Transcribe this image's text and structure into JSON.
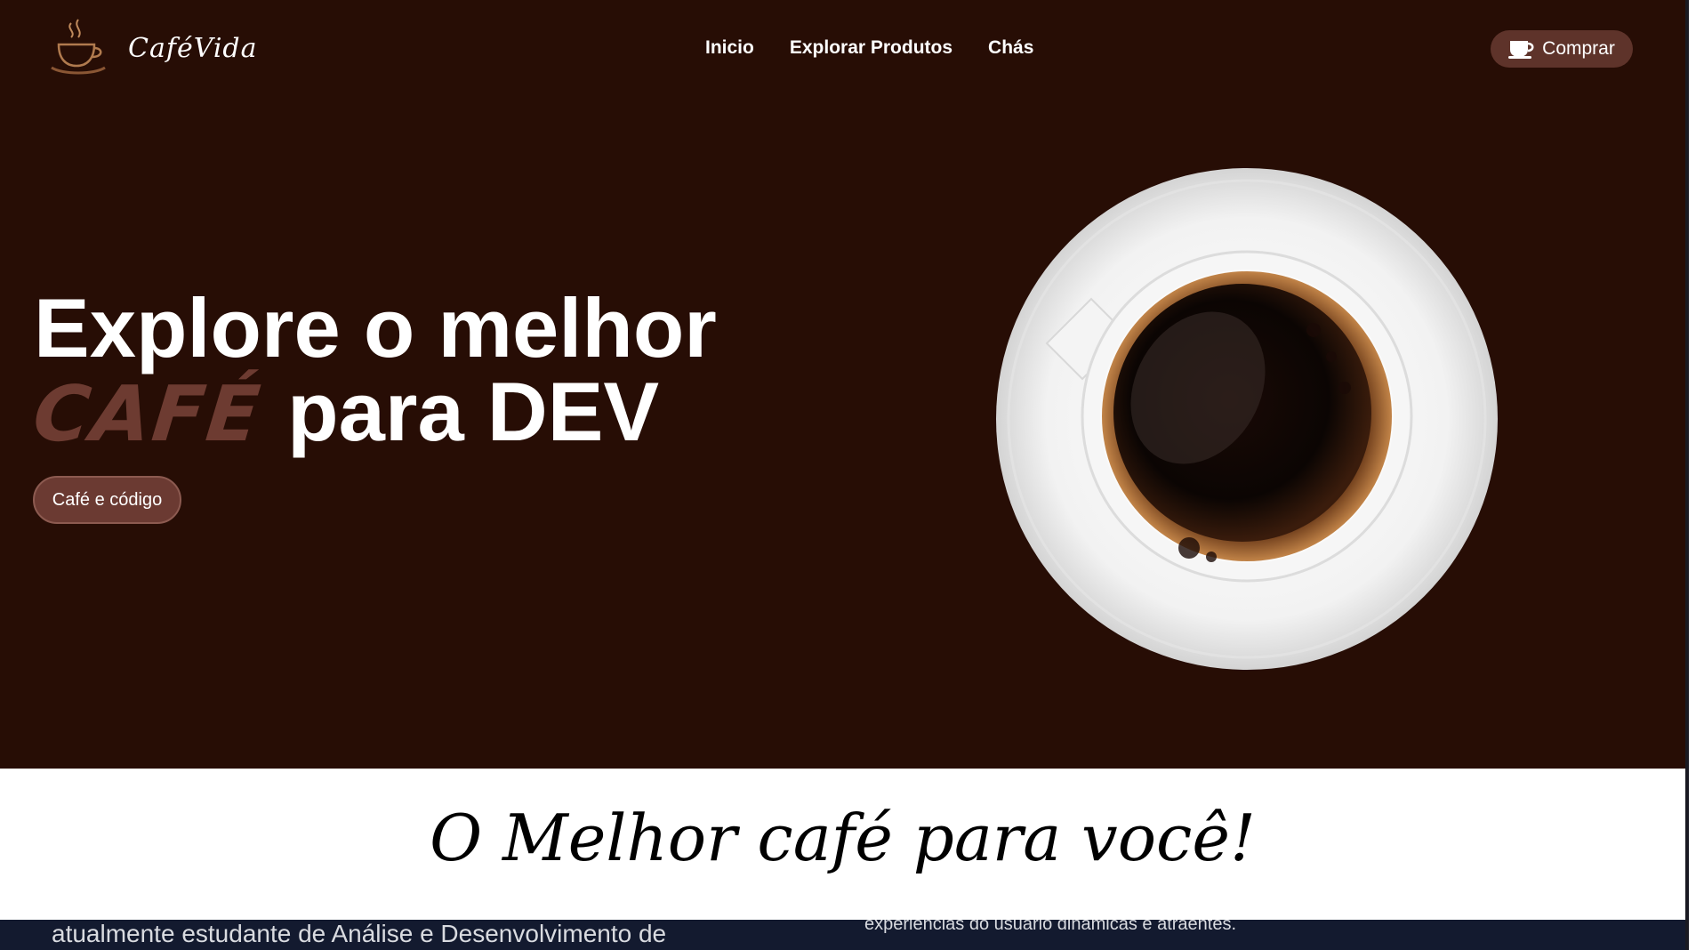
{
  "brand": {
    "name": "CaféVida",
    "logo_icon": "coffee-cup-icon"
  },
  "nav": {
    "items": [
      "Inicio",
      "Explorar Produtos",
      "Chás"
    ]
  },
  "header": {
    "buy_label": "Comprar",
    "buy_icon": "coffee-cup-icon"
  },
  "hero": {
    "headline_line1": "Explore o melhor",
    "headline_accent": "CAFÉ",
    "headline_rest": "para DEV",
    "cta_label": "Café e código",
    "image": "coffee-cup-top-view"
  },
  "section": {
    "tagline": "O Melhor café para você!",
    "partial_text_left": "atualmente estudante de Análise e Desenvolvimento de",
    "partial_text_right": "experiências do usuário dinâmicas e atraentes."
  },
  "colors": {
    "hero_bg": "#270d05",
    "accent": "#6d3b31",
    "button_bg": "#5e332a",
    "strip_bg": "#131a2f"
  }
}
